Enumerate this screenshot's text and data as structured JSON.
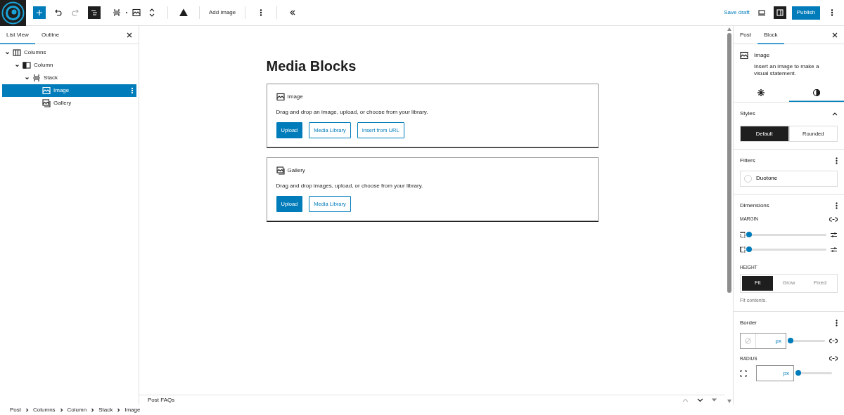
{
  "toolbar": {
    "inserter_active": true,
    "list_view_active": true,
    "add_label": "Add image",
    "save_label": "Save draft",
    "publish_label": "Publish",
    "sidebar_active": true
  },
  "left_panel": {
    "tabs": [
      {
        "label": "List View",
        "selected": true
      },
      {
        "label": "Outline",
        "selected": false
      }
    ],
    "tree": [
      {
        "label": "Columns",
        "kind": "columns",
        "expanded": true,
        "selected": false,
        "children": [
          {
            "label": "Column",
            "kind": "column",
            "expanded": true,
            "selected": false,
            "children": [
              {
                "label": "Stack",
                "kind": "stack",
                "expanded": true,
                "selected": false,
                "children": [
                  {
                    "label": "Image",
                    "kind": "image",
                    "selected": true
                  },
                  {
                    "label": "Gallery",
                    "kind": "gallery",
                    "selected": false
                  }
                ]
              }
            ]
          }
        ]
      }
    ]
  },
  "canvas": {
    "title": "Media Blocks",
    "blocks": [
      {
        "kind": "image",
        "title": "Image",
        "instructions": "Drag and drop an image, upload, or choose from your library.",
        "buttons": [
          {
            "label": "Upload",
            "primary": true
          },
          {
            "label": "Media Library",
            "primary": false
          },
          {
            "label": "Insert from URL",
            "primary": false
          }
        ]
      },
      {
        "kind": "gallery",
        "title": "Gallery",
        "instructions": "Drag and drop images, upload, or choose from your library.",
        "buttons": [
          {
            "label": "Upload",
            "primary": true
          },
          {
            "label": "Media Library",
            "primary": false
          }
        ]
      }
    ],
    "meta_box": "Post FAQs"
  },
  "right_panel": {
    "tabs": [
      {
        "label": "Post",
        "selected": false
      },
      {
        "label": "Block",
        "selected": true
      }
    ],
    "block_title": "Image",
    "block_description": "Insert an image to make a visual statement.",
    "subtabs": [
      {
        "kind": "settings",
        "selected": false
      },
      {
        "kind": "styles",
        "selected": true
      }
    ],
    "styles": {
      "title": "Styles",
      "expanded": true,
      "options": [
        {
          "label": "Default",
          "selected": true
        },
        {
          "label": "Rounded",
          "selected": false
        }
      ]
    },
    "filters": {
      "title": "Filters",
      "duotone": "Duotone"
    },
    "dimensions": {
      "title": "Dimensions",
      "margin_label": "MARGIN",
      "margin_sliders": [
        {
          "level": 0
        },
        {
          "level": 0
        }
      ],
      "height_label": "HEIGHT",
      "height_options": [
        {
          "label": "Fit",
          "selected": true
        },
        {
          "label": "Grow",
          "selected": false
        },
        {
          "label": "Fixed",
          "selected": false
        }
      ],
      "height_help": "Fit contents."
    },
    "border": {
      "title": "Border",
      "unit": "px",
      "width_slider": {
        "level": 0
      },
      "radius_label": "RADIUS",
      "radius_unit": "px",
      "radius_slider": {
        "level": 0
      }
    }
  },
  "breadcrumb": [
    "Post",
    "Columns",
    "Column",
    "Stack",
    "Image"
  ]
}
